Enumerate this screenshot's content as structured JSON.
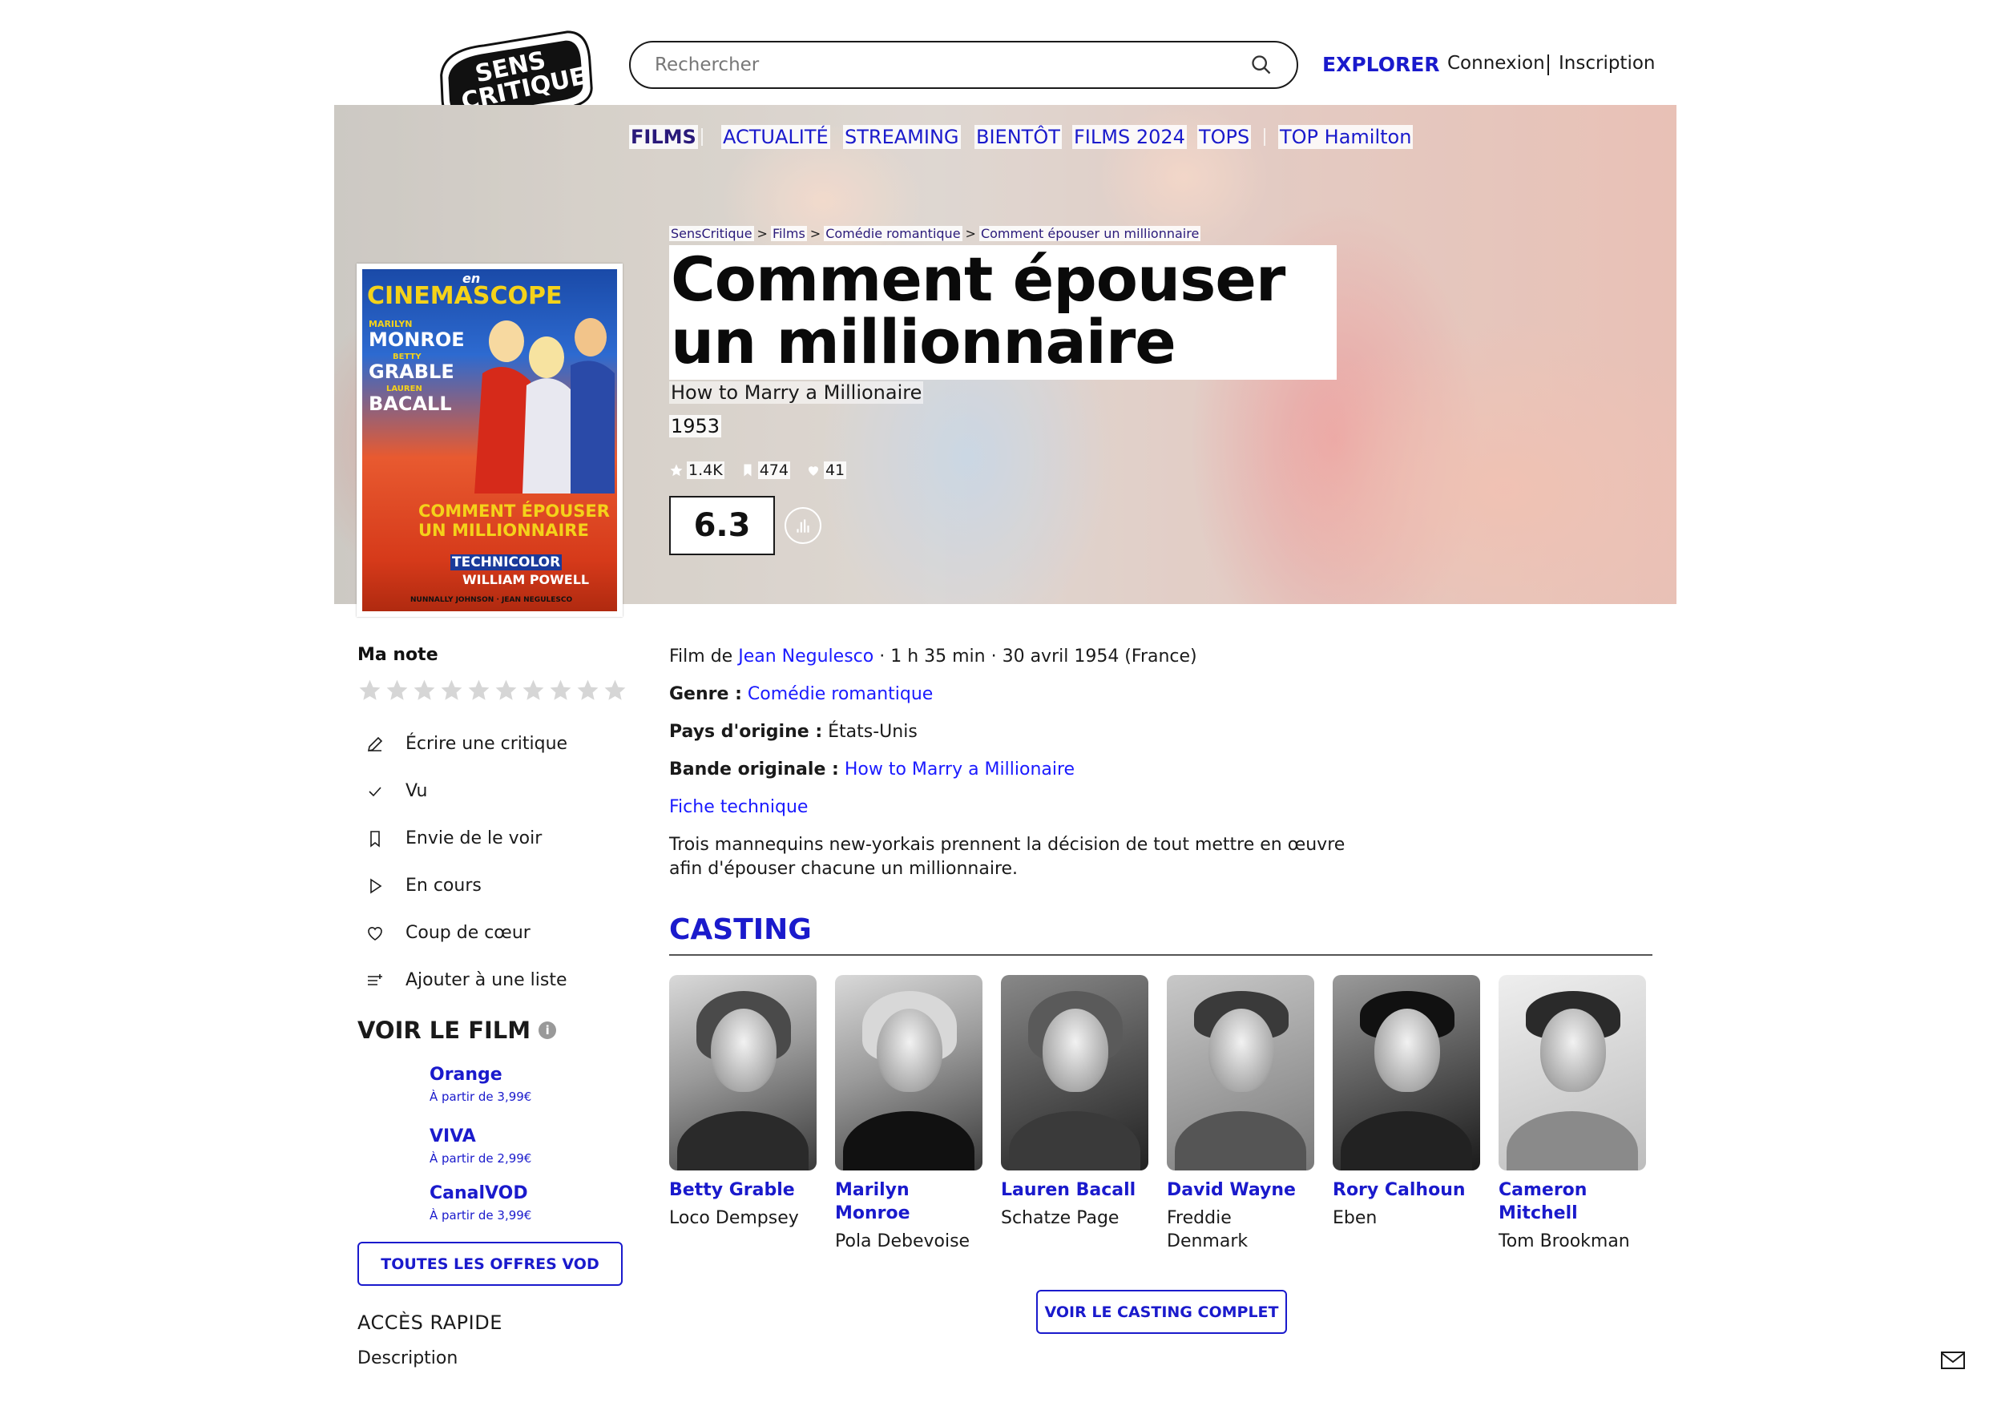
{
  "header": {
    "search_placeholder": "Rechercher",
    "explore": "EXPLORER",
    "login": "Connexion",
    "signup": "Inscription",
    "logo_text": [
      "SENS",
      "CRITIQUE"
    ]
  },
  "nav": {
    "items": [
      {
        "label": "FILMS",
        "active": true
      },
      {
        "label": "ACTUALITÉ"
      },
      {
        "label": "STREAMING"
      },
      {
        "label": "BIENTÔT"
      },
      {
        "label": "FILMS 2024"
      },
      {
        "label": "TOPS"
      },
      {
        "label": "TOP Hamilton"
      }
    ]
  },
  "breadcrumb": [
    "SensCritique",
    "Films",
    "Comédie romantique",
    "Comment épouser un millionnaire"
  ],
  "film": {
    "title": "Comment épouser un millionnaire",
    "original_title": "How to Marry a Millionaire",
    "year": "1953",
    "stats": {
      "ratings": "1.4K",
      "wishlist": "474",
      "favorites": "41"
    },
    "score": "6.3",
    "director_prefix": "Film de ",
    "director": "Jean Negulesco",
    "meta_suffix": " · 1 h 35 min · 30 avril 1954 (France)",
    "genre_label": "Genre :",
    "genre": "Comédie romantique",
    "country_label": "Pays d'origine :",
    "country": "États-Unis",
    "soundtrack_label": "Bande originale :",
    "soundtrack": "How to Marry a Millionaire",
    "tech_sheet": "Fiche technique",
    "synopsis": "Trois mannequins new-yorkais prennent la décision de tout mettre en œuvre afin d'épouser chacune un millionnaire."
  },
  "poster": {
    "lines": [
      "en",
      "CINEMASCOPE",
      "MARILYN",
      "MONROE",
      "BETTY",
      "GRABLE",
      "LAUREN",
      "BACALL",
      "COMMENT ÉPOUSER",
      "UN MILLIONNAIRE",
      "TECHNICOLOR",
      "WILLIAM POWELL",
      "NUNNALLY JOHNSON · JEAN NEGULESCO"
    ]
  },
  "sidebar": {
    "my_rating": "Ma note",
    "star_count": 10,
    "actions": [
      {
        "label": "Écrire une critique",
        "icon": "pencil-icon"
      },
      {
        "label": "Vu",
        "icon": "check-icon"
      },
      {
        "label": "Envie de le voir",
        "icon": "bookmark-icon"
      },
      {
        "label": "En cours",
        "icon": "play-icon"
      },
      {
        "label": "Coup de cœur",
        "icon": "heart-icon"
      },
      {
        "label": "Ajouter à une liste",
        "icon": "list-add-icon"
      }
    ],
    "watch_title": "VOIR LE FILM",
    "vod": [
      {
        "name": "Orange",
        "price": "À partir de 3,99€"
      },
      {
        "name": "VIVA",
        "price": "À partir de 2,99€"
      },
      {
        "name": "CanalVOD",
        "price": "À partir de 3,99€"
      }
    ],
    "vod_button": "TOUTES LES OFFRES VOD",
    "quick_access": "ACCÈS RAPIDE",
    "quick_links": [
      "Description"
    ]
  },
  "casting": {
    "title": "CASTING",
    "actors": [
      {
        "name": "Betty Grable",
        "role": "Loco Dempsey"
      },
      {
        "name": "Marilyn Monroe",
        "role": "Pola Debevoise"
      },
      {
        "name": "Lauren Bacall",
        "role": "Schatze Page"
      },
      {
        "name": "David Wayne",
        "role": "Freddie Denmark"
      },
      {
        "name": "Rory Calhoun",
        "role": "Eben"
      },
      {
        "name": "Cameron Mitchell",
        "role": "Tom Brookman"
      }
    ],
    "button": "VOIR LE CASTING COMPLET"
  },
  "colors": {
    "accent": "#1a1acc",
    "text": "#1a1a1a",
    "star_empty": "#d6d6d6"
  }
}
